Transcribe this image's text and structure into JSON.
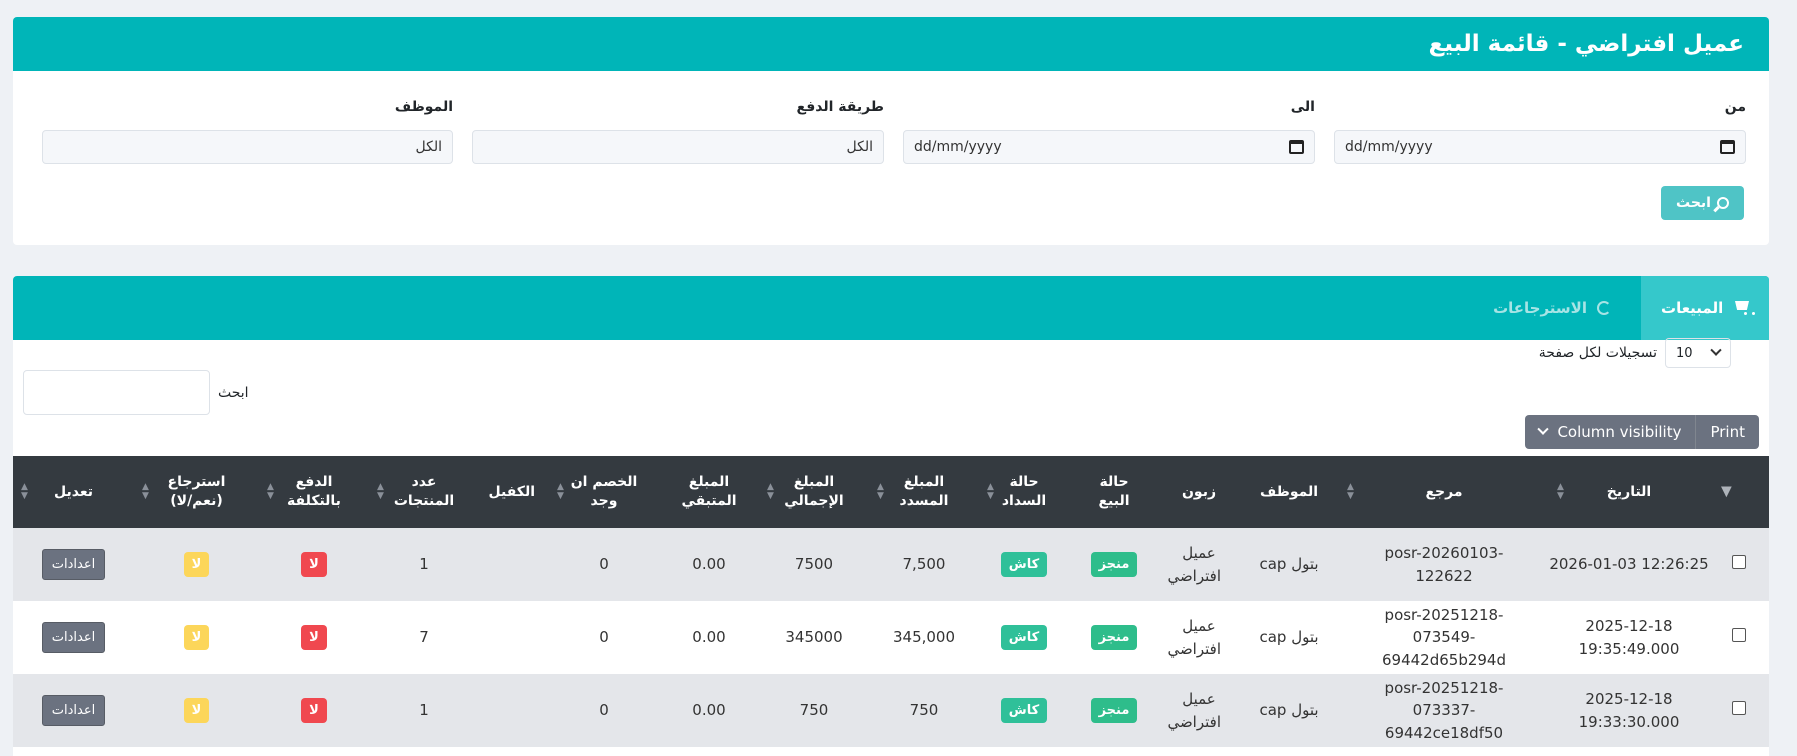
{
  "header": {
    "title": "عميل افتراضي - قائمة البيع"
  },
  "filters": {
    "from_label": "من",
    "to_label": "الى",
    "payment_label": "طريقة الدفع",
    "employee_label": "الموظف",
    "from_value": "dd/mm/yyyy",
    "to_value": "dd/mm/yyyy",
    "payment_value": "الكل",
    "employee_value": "الكل",
    "search_button": "ابحث"
  },
  "tabs": {
    "sales": "المبيعات",
    "returns": "الاسترجاعات"
  },
  "table_controls": {
    "page_length": "10",
    "page_length_label": "تسجيلات لكل صفحة",
    "search_label": "ابحث",
    "print": "Print",
    "column_visibility": "Column visibility"
  },
  "columns": {
    "date": "التاريخ",
    "ref": "مرجع",
    "employee": "الموظف",
    "customer": "زبون",
    "sale_status": "حالة البيع",
    "payment_status": "حالة السداد",
    "paid": "المبلغ المسدد",
    "total": "المبلغ الإجمالي",
    "remaining": "المبلغ المتبقي",
    "discount": "الخصم ان وجد",
    "guarantor": "الكفيل",
    "items": "عدد المنتجات",
    "at_cost": "الدفع بالتكلفة",
    "returned": "استرجاع (نعم/لا)",
    "edit": "تعديل"
  },
  "rows": [
    {
      "date": "2026-01-03 12:26:25",
      "ref": "posr-20260103-122622",
      "employee": "بتول cap",
      "customer": "عميل افتراضي",
      "sale_status": "منجز",
      "payment_status": "كاش",
      "paid": "7,500",
      "total": "7500",
      "remaining": "0.00",
      "discount": "0",
      "guarantor": "",
      "items": "1",
      "at_cost": "لا",
      "returned": "لا",
      "action": "اعدادات"
    },
    {
      "date": "2025-12-18 19:35:49.000",
      "ref": "posr-20251218-073549-69442d65b294d",
      "employee": "بتول cap",
      "customer": "عميل افتراضي",
      "sale_status": "منجز",
      "payment_status": "كاش",
      "paid": "345,000",
      "total": "345000",
      "remaining": "0.00",
      "discount": "0",
      "guarantor": "",
      "items": "7",
      "at_cost": "لا",
      "returned": "لا",
      "action": "اعدادات"
    },
    {
      "date": "2025-12-18 19:33:30.000",
      "ref": "posr-20251218-073337-69442ce18df50",
      "employee": "بتول cap",
      "customer": "عميل افتراضي",
      "sale_status": "منجز",
      "payment_status": "كاش",
      "paid": "750",
      "total": "750",
      "remaining": "0.00",
      "discount": "0",
      "guarantor": "",
      "items": "1",
      "at_cost": "لا",
      "returned": "لا",
      "action": "اعدادات"
    }
  ],
  "colors": {
    "primary": "#00b5b8",
    "table_header": "#343a40",
    "success": "#2ebd8b",
    "danger": "#f0484f",
    "warning": "#fcd65a"
  }
}
